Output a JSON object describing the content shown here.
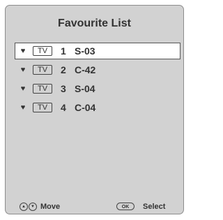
{
  "title": "Favourite List",
  "items": [
    {
      "source": "TV",
      "number": "1",
      "name": "S-03",
      "selected": true
    },
    {
      "source": "TV",
      "number": "2",
      "name": "C-42",
      "selected": false
    },
    {
      "source": "TV",
      "number": "3",
      "name": "S-04",
      "selected": false
    },
    {
      "source": "TV",
      "number": "4",
      "name": "C-04",
      "selected": false
    }
  ],
  "footer": {
    "move_label": "Move",
    "ok_label": "OK",
    "select_label": "Select"
  },
  "icons": {
    "favourite": "heart-icon",
    "nav": [
      "up-arrow-icon",
      "down-arrow-icon"
    ]
  }
}
